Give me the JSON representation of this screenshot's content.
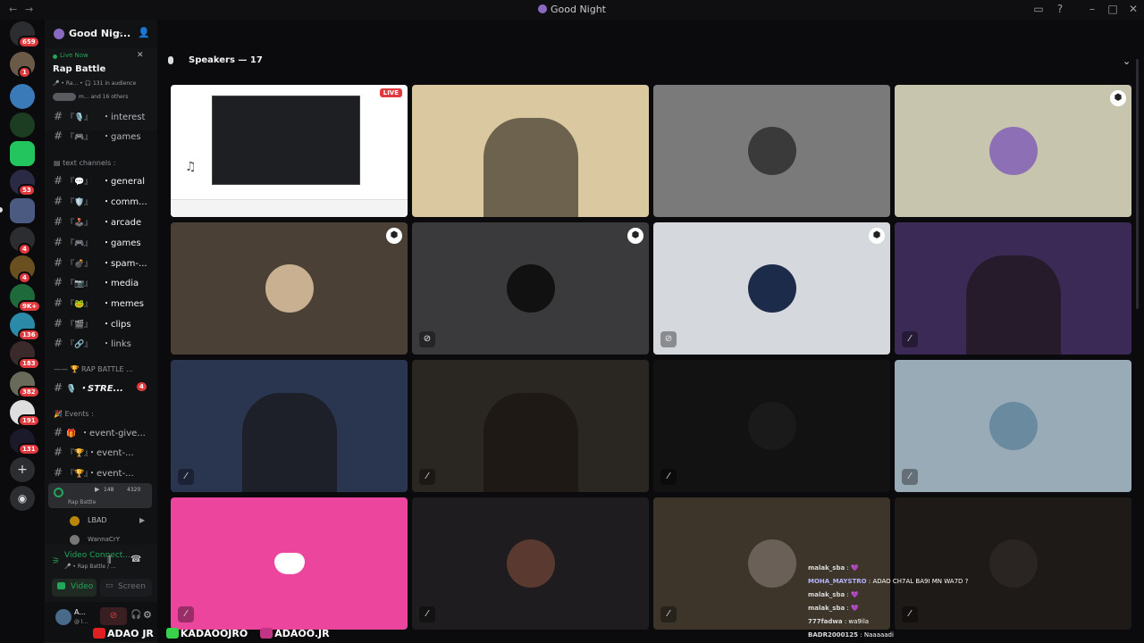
{
  "window": {
    "title": "Good Night",
    "nav_back": "←",
    "nav_fwd": "→"
  },
  "rail": {
    "badges": [
      "659",
      "1",
      "53",
      "4",
      "4",
      "9K+",
      "136",
      "183",
      "382",
      "191",
      "131"
    ]
  },
  "sidebar": {
    "server_name": "Good Nig...",
    "live": {
      "status": "Live Now",
      "title": "Rap Battle",
      "sub": "🎤 • Ra...  • 🎧 131 in audience",
      "others": "m... and 16 others"
    },
    "channels_top": [
      {
        "emoji": "『🎙️』",
        "name": "・interest"
      },
      {
        "emoji": "『🎮』",
        "name": "・games"
      }
    ],
    "text_category": "text channels :",
    "text_channels": [
      {
        "emoji": "『💬』",
        "name": "・general"
      },
      {
        "emoji": "『🛡️』",
        "name": "・comm..."
      },
      {
        "emoji": "『🕹️』",
        "name": "・arcade"
      },
      {
        "emoji": "『🎮』",
        "name": "・games"
      },
      {
        "emoji": "『💣』",
        "name": "・spam-..."
      },
      {
        "emoji": "『📷』",
        "name": "・media"
      },
      {
        "emoji": "『🐸』",
        "name": "・memes"
      },
      {
        "emoji": "『🎬』",
        "name": "・clips"
      },
      {
        "emoji": "『🔗』",
        "name": "・links"
      }
    ],
    "rap_category": "—— 🏆 RAP BATTLE ...",
    "stream_channel": {
      "emoji": "🎙️",
      "name": "・STRE...",
      "badge": "4"
    },
    "events_category": "🎉 Events :",
    "events_channels": [
      {
        "emoji": "🎁",
        "name": "・event-give..."
      },
      {
        "emoji": "『🏆』",
        "name": "・event-..."
      },
      {
        "emoji": "『🏆』",
        "name": "・event-..."
      }
    ],
    "stage": {
      "label": "Rap Battle",
      "count_a": "148",
      "count_b": "4320"
    },
    "members": [
      {
        "name": "LBAD"
      },
      {
        "name": "WannaCrY"
      }
    ],
    "voice": {
      "status": "Video Connect...",
      "sub": "🎤 • Rap Battle / ...",
      "video_label": "Video",
      "screen_label": "Screen"
    },
    "user": {
      "name": "A...",
      "sub": "@ l..."
    }
  },
  "main": {
    "heading": "Speakers — 17",
    "live_tag": "LIVE",
    "tiles": [
      {
        "kind": "screen",
        "bg": "#ffffff"
      },
      {
        "kind": "video",
        "bg": "#d9c8a0"
      },
      {
        "kind": "avatar",
        "bg": "#7a7a7a",
        "avatar": "#3a3a3a"
      },
      {
        "kind": "avatar",
        "bg": "#c7c5ae",
        "avatar": "#8d6fb5",
        "shield": true
      },
      {
        "kind": "avatar",
        "bg": "#4a4035",
        "avatar": "#c8b090",
        "shield": true
      },
      {
        "kind": "avatar",
        "bg": "#3a3a3c",
        "avatar": "#111111",
        "shield": true
      },
      {
        "kind": "avatar",
        "bg": "#d5d8dc",
        "avatar": "#1d2b4a",
        "shield": true
      },
      {
        "kind": "video",
        "bg": "#3a2a55"
      },
      {
        "kind": "video",
        "bg": "#2a3550"
      },
      {
        "kind": "video",
        "bg": "#2a2622"
      },
      {
        "kind": "avatar",
        "bg": "#121212",
        "avatar": "#1a1a1a"
      },
      {
        "kind": "avatar",
        "bg": "#9aabb8",
        "avatar": "#6a8aa0"
      },
      {
        "kind": "discord",
        "bg": "#eb459e"
      },
      {
        "kind": "avatar",
        "bg": "#1e1c1e",
        "avatar": "#5a3a30"
      },
      {
        "kind": "avatar",
        "bg": "#3d3529",
        "avatar": "#6a6058"
      },
      {
        "kind": "avatar",
        "bg": "#1e1a17",
        "avatar": "#2a2422"
      }
    ],
    "chat": [
      {
        "user": "malak_sba",
        "msg": "💜"
      },
      {
        "user": "MOHA_MAYSTRO",
        "msg": "ADAO CH7AL BA9I MN WA7D ?"
      },
      {
        "user": "malak_sba",
        "msg": "💜"
      },
      {
        "user": "malak_sba",
        "msg": "💜"
      },
      {
        "user": "777fadwa",
        "msg": "wa9ila"
      },
      {
        "user": "BADR2000125",
        "msg": "Naaaaadi"
      }
    ],
    "socials": [
      {
        "name": "ADAO JR",
        "color": "#e02020"
      },
      {
        "name": "KADAOOJRO",
        "color": "#39d04a"
      },
      {
        "name": "ADAOO.JR",
        "color": "#c13584"
      }
    ]
  },
  "colors": {
    "accent": "#5865f2",
    "live_green": "#23a55a",
    "badge_red": "#e0393e"
  }
}
